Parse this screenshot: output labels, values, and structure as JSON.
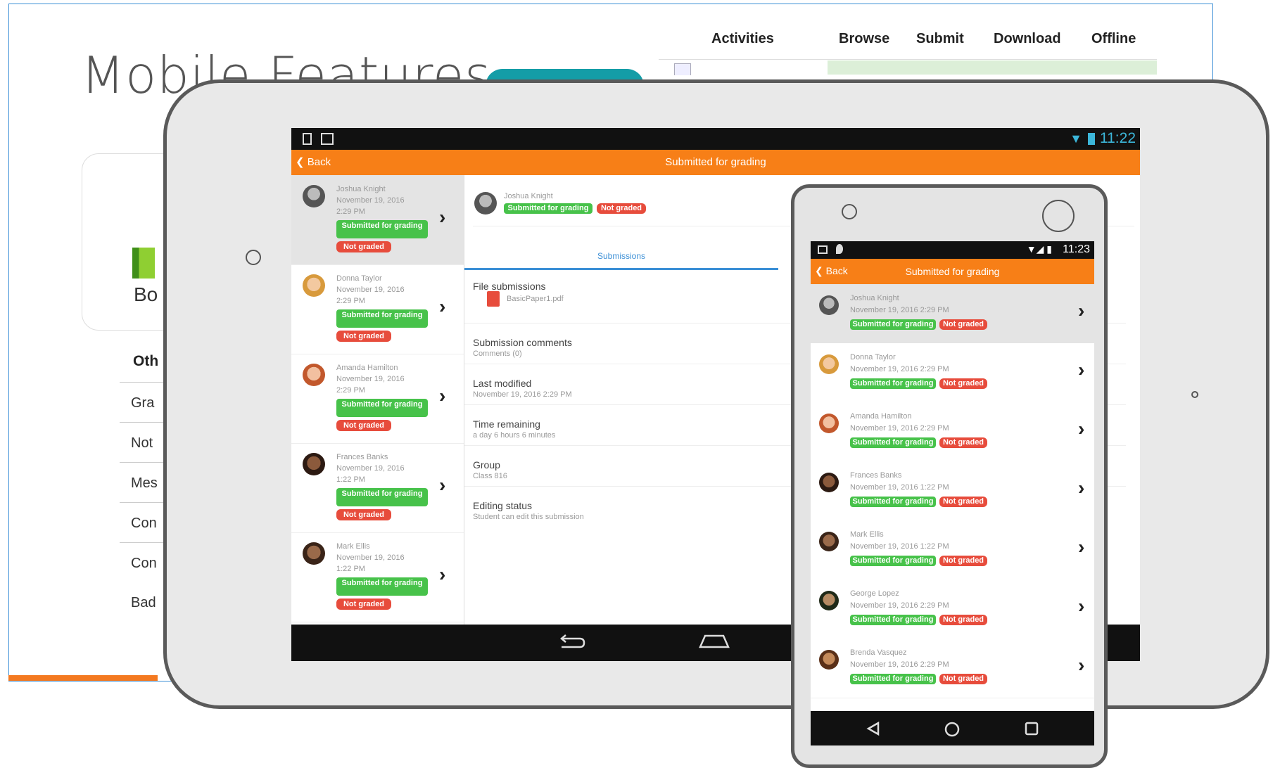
{
  "background": {
    "title": "Mobile Features",
    "header_tabs": [
      "Activities",
      "Browse",
      "Submit",
      "Download",
      "Offline"
    ],
    "card_label": "Bo",
    "other_heading": "Oth",
    "list_rows": [
      "Gra",
      "Not",
      "Mes",
      "Con",
      "Con",
      "Bad"
    ]
  },
  "tablet": {
    "status_time": "11:22",
    "header": {
      "back": "Back",
      "title": "Submitted for grading"
    },
    "submissions": [
      {
        "name": "Joshua Knight",
        "date": "November 19, 2016",
        "time": "2:29 PM",
        "status": "Submitted for grading",
        "grade": "Not graded"
      },
      {
        "name": "Donna Taylor",
        "date": "November 19, 2016",
        "time": "2:29 PM",
        "status": "Submitted for grading",
        "grade": "Not graded"
      },
      {
        "name": "Amanda Hamilton",
        "date": "November 19, 2016",
        "time": "2:29 PM",
        "status": "Submitted for grading",
        "grade": "Not graded"
      },
      {
        "name": "Frances Banks",
        "date": "November 19, 2016",
        "time": "1:22 PM",
        "status": "Submitted for grading",
        "grade": "Not graded"
      },
      {
        "name": "Mark Ellis",
        "date": "November 19, 2016",
        "time": "1:22 PM",
        "status": "Submitted for grading",
        "grade": "Not graded"
      }
    ],
    "detail": {
      "student": "Joshua Knight",
      "status": "Submitted for grading",
      "grade": "Not graded",
      "tab": "Submissions",
      "file_label": "File submissions",
      "file_name": "BasicPaper1.pdf",
      "comments_label": "Submission comments",
      "comments_value": "Comments (0)",
      "modified_label": "Last modified",
      "modified_value": "November 19, 2016 2:29 PM",
      "remaining_label": "Time remaining",
      "remaining_value": "a day 6 hours 6 minutes",
      "group_label": "Group",
      "group_value": "Class 816",
      "editing_label": "Editing status",
      "editing_value": "Student can edit this submission"
    }
  },
  "phone": {
    "status_time": "11:23",
    "header": {
      "back": "Back",
      "title": "Submitted for grading"
    },
    "submissions": [
      {
        "name": "Joshua Knight",
        "date": "November 19, 2016 2:29 PM",
        "status": "Submitted for grading",
        "grade": "Not graded"
      },
      {
        "name": "Donna Taylor",
        "date": "November 19, 2016 2:29 PM",
        "status": "Submitted for grading",
        "grade": "Not graded"
      },
      {
        "name": "Amanda Hamilton",
        "date": "November 19, 2016 2:29 PM",
        "status": "Submitted for grading",
        "grade": "Not graded"
      },
      {
        "name": "Frances Banks",
        "date": "November 19, 2016 1:22 PM",
        "status": "Submitted for grading",
        "grade": "Not graded"
      },
      {
        "name": "Mark Ellis",
        "date": "November 19, 2016 1:22 PM",
        "status": "Submitted for grading",
        "grade": "Not graded"
      },
      {
        "name": "George Lopez",
        "date": "November 19, 2016 2:29 PM",
        "status": "Submitted for grading",
        "grade": "Not graded"
      },
      {
        "name": "Brenda Vasquez",
        "date": "November 19, 2016 2:29 PM",
        "status": "Submitted for grading",
        "grade": "Not graded"
      }
    ]
  },
  "colors": {
    "accent_orange": "#f77f17",
    "success_green": "#47c24a",
    "danger_red": "#e74c3c",
    "link_blue": "#3b8fd6"
  }
}
